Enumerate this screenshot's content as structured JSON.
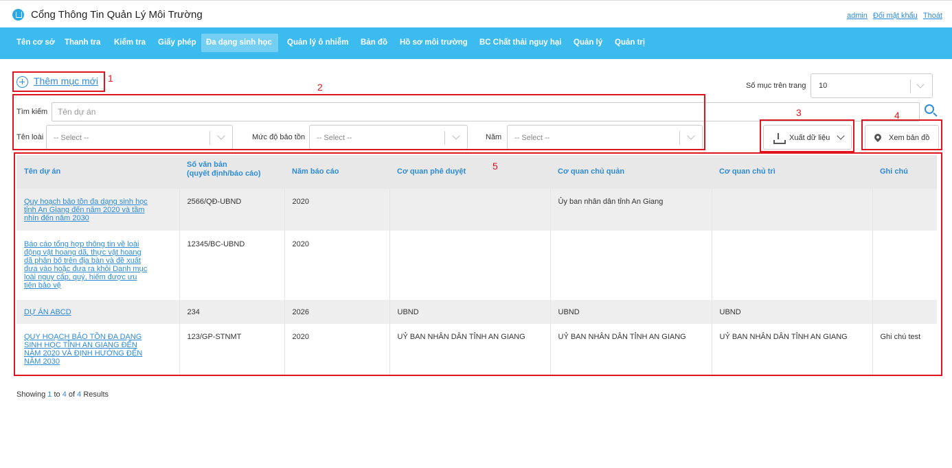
{
  "header": {
    "app_title": "Cổng Thông Tin Quản Lý Môi Trường",
    "links": [
      "admin",
      "Đổi mật khẩu",
      "Thoát"
    ]
  },
  "nav": {
    "items": [
      "Tên cơ sở",
      "Thanh tra",
      "Kiểm tra",
      "Giấy phép",
      "Đa dạng sinh học",
      "Quản lý ô nhiễm",
      "Bản đồ",
      "Hồ sơ môi trường",
      "BC Chất thải nguy hại",
      "Quản lý",
      "Quản trị"
    ],
    "active": "Đa dạng sinh học"
  },
  "toolbar": {
    "add_label": "Thêm mục mới",
    "per_page_label": "Số mục trên trang",
    "per_page_value": "10",
    "search_label": "Tìm kiếm",
    "search_placeholder": "Tên dự án",
    "search_value": "",
    "filters": [
      {
        "label": "Tên loài",
        "placeholder": "-- Select --"
      },
      {
        "label": "Mức độ bảo tồn",
        "placeholder": "-- Select --"
      },
      {
        "label": "Năm",
        "placeholder": "-- Select --"
      }
    ],
    "export_label": "Xuất dữ liệu",
    "map_label": "Xem bản đồ"
  },
  "annotations": [
    "1",
    "2",
    "3",
    "4",
    "5"
  ],
  "table": {
    "columns": [
      {
        "line1": "Tên dự án",
        "line2": ""
      },
      {
        "line1": "Số văn bản",
        "line2": "(quyết định/báo cáo)"
      },
      {
        "line1": "Năm báo cáo",
        "line2": ""
      },
      {
        "line1": "Cơ quan phê duyệt",
        "line2": ""
      },
      {
        "line1": "Cơ quan chủ quản",
        "line2": ""
      },
      {
        "line1": "Cơ quan chủ trì",
        "line2": ""
      },
      {
        "line1": "Ghi chú",
        "line2": ""
      }
    ],
    "rows": [
      {
        "name_lines": [
          "Quy hoạch bảo tồn đa dạng sinh học",
          "tỉnh An Giang đến năm 2020 và tầm",
          "nhìn đến năm 2030"
        ],
        "doc_no": "2566/QĐ-UBND",
        "year": "2020",
        "approver": "",
        "managing": "Ủy ban nhân dân tỉnh An Giang",
        "lead": "",
        "note": ""
      },
      {
        "name_lines": [
          "Báo cáo tổng hợp thông tin về loài",
          "động vật hoang dã, thực vật hoang",
          "dã phân bố trên địa bàn và đề xuất",
          "đưa vào hoặc đưa ra khỏi Danh mục",
          "loài nguy cấp, quý, hiếm được ưu",
          "tiên bảo vệ"
        ],
        "doc_no": "12345/BC-UBND",
        "year": "2020",
        "approver": "",
        "managing": "",
        "lead": "",
        "note": ""
      },
      {
        "name_lines": [
          "DỰ ÁN ABCD"
        ],
        "doc_no": "234",
        "year": "2026",
        "approver": "UBND",
        "managing": "UBND",
        "lead": "UBND",
        "note": ""
      },
      {
        "name_lines": [
          "QUY HOẠCH BẢO TỒN ĐA DẠNG",
          "SINH HỌC TỈNH AN GIANG ĐẾN",
          "NĂM 2020 VÀ ĐỊNH HƯỚNG ĐẾN",
          "NĂM 2030"
        ],
        "doc_no": "123/GP-STNMT",
        "year": "2020",
        "approver": "UỶ BAN NHÂN DÂN TỈNH AN GIANG",
        "managing": "UỶ BAN NHÂN DÂN TỈNH AN GIANG",
        "lead": "UỶ BAN NHÂN DÂN TỈNH AN GIANG",
        "note": "Ghi chú test"
      }
    ]
  },
  "footer": {
    "prefix": "Showing",
    "from": "1",
    "mid1": "to",
    "to": "4",
    "mid2": "of",
    "total": "4",
    "suffix": "Results"
  },
  "colors": {
    "accent": "#3cbbee",
    "link": "#2d8bd9",
    "annotation": "#e0141e"
  }
}
